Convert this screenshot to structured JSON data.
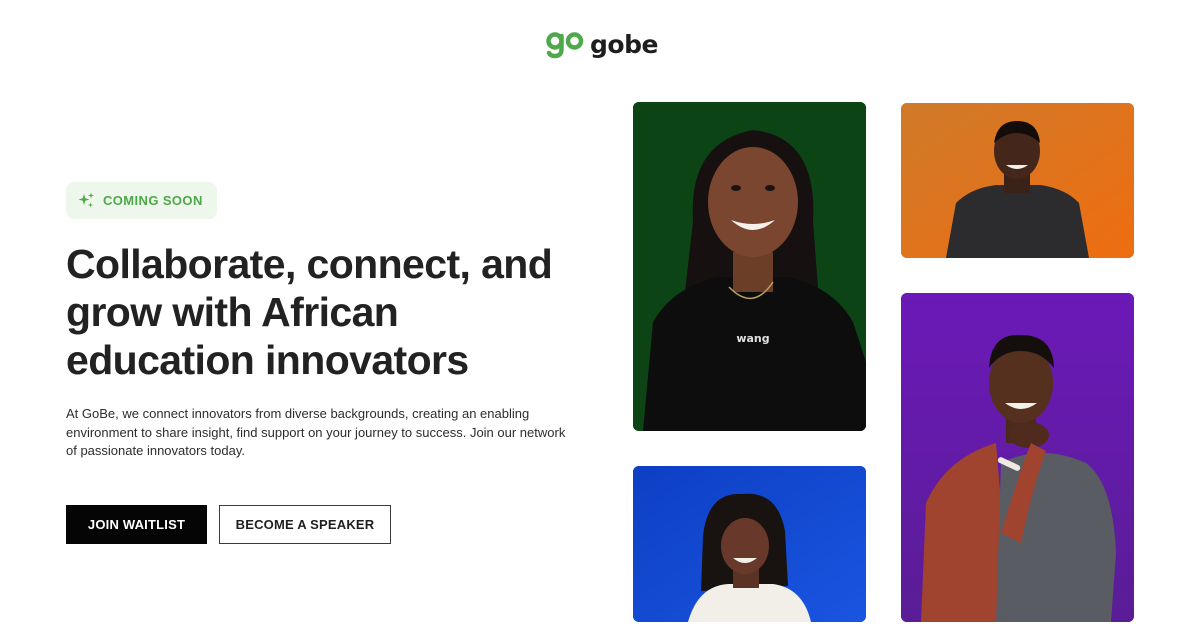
{
  "brand": {
    "name": "gobe",
    "mark_text": "go",
    "mark_color": "#4fa84a"
  },
  "hero": {
    "badge": {
      "icon": "sparkle-icon",
      "label": "COMING SOON"
    },
    "headline": "Collaborate, connect, and grow with African education innovators",
    "description": "At GoBe, we connect innovators from diverse backgrounds, creating an enabling environment to share insight, find support on your journey to success. Join our network of passionate innovators today.",
    "buttons": {
      "primary": "JOIN WAITLIST",
      "secondary": "BECOME A SPEAKER"
    }
  },
  "gallery": {
    "photos": [
      {
        "background": "#0e4a17",
        "shirt_text": "wang"
      },
      {
        "background": "#e0781e"
      },
      {
        "background": "#1147cf"
      },
      {
        "background": "#6a1fb0"
      }
    ]
  },
  "colors": {
    "accent": "#4fa84a",
    "badge_bg": "#eef7ec",
    "primary_button": "#050505"
  }
}
